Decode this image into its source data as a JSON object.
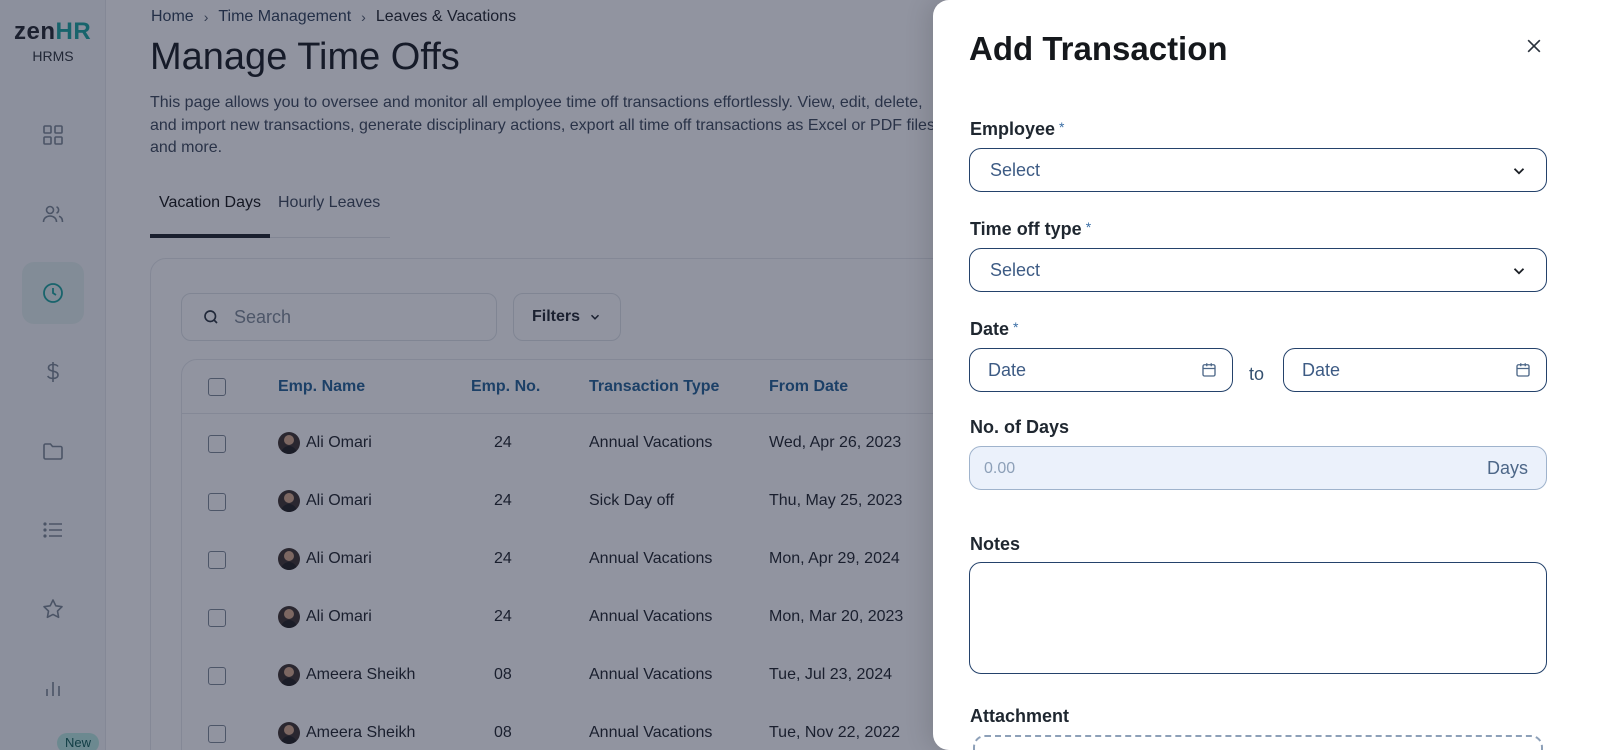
{
  "brand": {
    "logo_main": "zen",
    "logo_accent": "HR",
    "subtitle": "HRMS"
  },
  "sidebar": {
    "items": [
      {
        "name": "dashboard",
        "icon": "grid-icon"
      },
      {
        "name": "people",
        "icon": "users-icon"
      },
      {
        "name": "time",
        "icon": "clock-icon",
        "active": true
      },
      {
        "name": "payroll",
        "icon": "dollar-icon"
      },
      {
        "name": "documents",
        "icon": "folder-icon"
      },
      {
        "name": "lists",
        "icon": "list-icon"
      },
      {
        "name": "favorites",
        "icon": "star-icon"
      },
      {
        "name": "reports",
        "icon": "bar-chart-icon"
      }
    ],
    "new_badge": "New"
  },
  "breadcrumb": {
    "home": "Home",
    "section": "Time Management",
    "current": "Leaves & Vacations"
  },
  "page": {
    "title": "Manage Time Offs",
    "description": "This page allows you to oversee and monitor all employee time off transactions effortlessly. View, edit, delete, and import new transactions, generate disciplinary actions, export all time off transactions as Excel or PDF files, and more."
  },
  "tabs": {
    "vacation_days": "Vacation Days",
    "hourly_leaves": "Hourly Leaves"
  },
  "toolbar": {
    "search_placeholder": "Search",
    "filters_label": "Filters"
  },
  "table": {
    "columns": {
      "name": "Emp. Name",
      "number": "Emp. No.",
      "type": "Transaction Type",
      "from": "From Date"
    },
    "rows": [
      {
        "name": "Ali Omari",
        "number": "24",
        "type": "Annual Vacations",
        "from": "Wed, Apr 26, 2023"
      },
      {
        "name": "Ali Omari",
        "number": "24",
        "type": "Sick Day off",
        "from": "Thu, May 25, 2023"
      },
      {
        "name": "Ali Omari",
        "number": "24",
        "type": "Annual Vacations",
        "from": "Mon, Apr 29, 2024"
      },
      {
        "name": "Ali Omari",
        "number": "24",
        "type": "Annual Vacations",
        "from": "Mon, Mar 20, 2023"
      },
      {
        "name": "Ameera Sheikh",
        "number": "08",
        "type": "Annual Vacations",
        "from": "Tue, Jul 23, 2024"
      },
      {
        "name": "Ameera Sheikh",
        "number": "08",
        "type": "Annual Vacations",
        "from": "Tue, Nov 22, 2022"
      }
    ]
  },
  "drawer": {
    "title": "Add Transaction",
    "employee": {
      "label": "Employee",
      "required": "*",
      "value": "Select"
    },
    "time_off_type": {
      "label": "Time off type",
      "required": "*",
      "value": "Select"
    },
    "date": {
      "label": "Date",
      "required": "*",
      "from_placeholder": "Date",
      "to_text": "to",
      "to_placeholder": "Date"
    },
    "no_of_days": {
      "label": "No. of Days",
      "value": "0.00",
      "unit": "Days"
    },
    "notes": {
      "label": "Notes",
      "value": ""
    },
    "attachment": {
      "label": "Attachment"
    }
  },
  "colors": {
    "accent": "#18a39b",
    "link": "#1f5e93",
    "border_dark": "#24426b",
    "overlay": "#192038"
  }
}
